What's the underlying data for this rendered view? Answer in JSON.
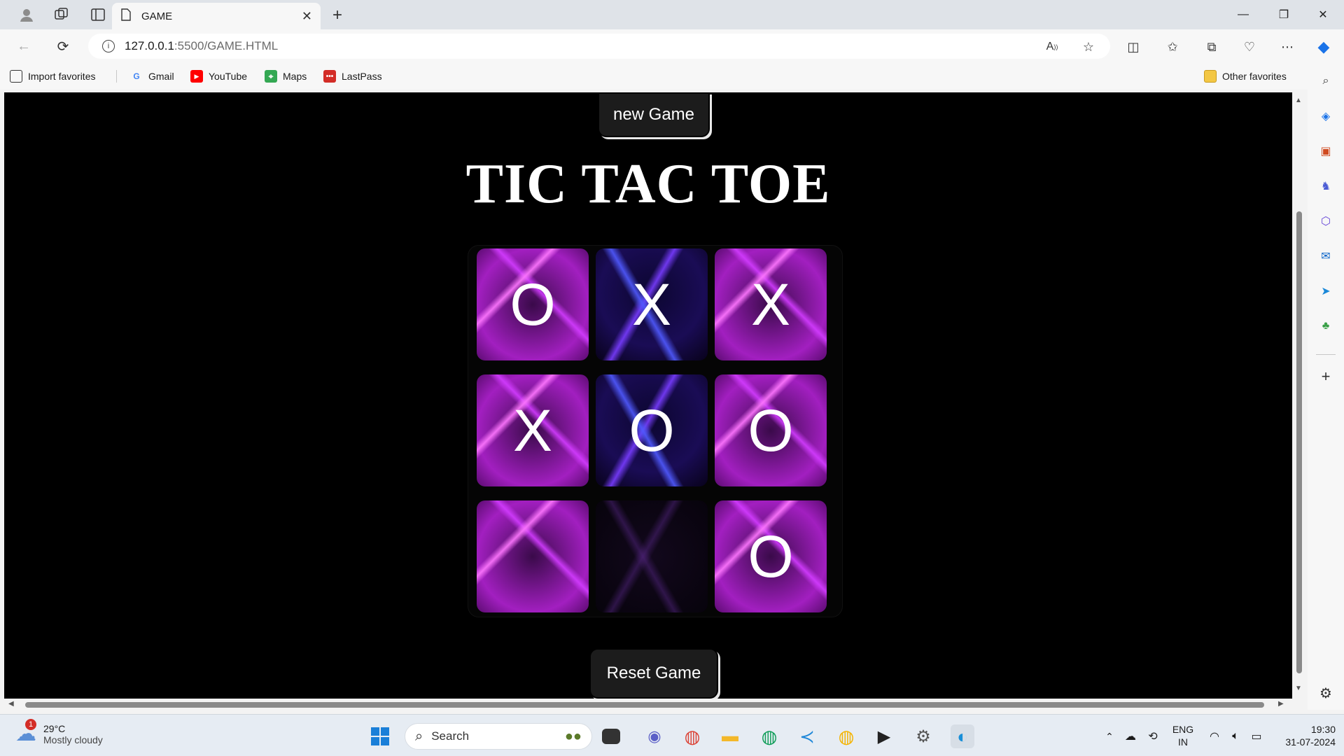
{
  "browser": {
    "tab_title": "GAME",
    "url_host": "127.0.0.1",
    "url_path": ":5500/GAME.HTML"
  },
  "favorites": {
    "import_label": "Import favorites",
    "items": [
      "Gmail",
      "YouTube",
      "Maps",
      "LastPass"
    ],
    "other_label": "Other favorites"
  },
  "game": {
    "new_game_label": "new Game",
    "title": "TIC TAC TOE",
    "reset_label": "Reset Game",
    "board": [
      [
        "O",
        "X",
        "X"
      ],
      [
        "X",
        "O",
        "O"
      ],
      [
        "",
        "",
        "O"
      ]
    ]
  },
  "taskbar": {
    "weather_temp": "29°C",
    "weather_desc": "Mostly cloudy",
    "weather_badge": "1",
    "search_placeholder": "Search",
    "lang_top": "ENG",
    "lang_bottom": "IN",
    "time": "19:30",
    "date": "31-07-2024"
  },
  "colors": {
    "page_bg": "#000000",
    "button_bg": "#1c1c1c",
    "accent_pink": "#c23de0",
    "accent_blue": "#4a4cff"
  }
}
